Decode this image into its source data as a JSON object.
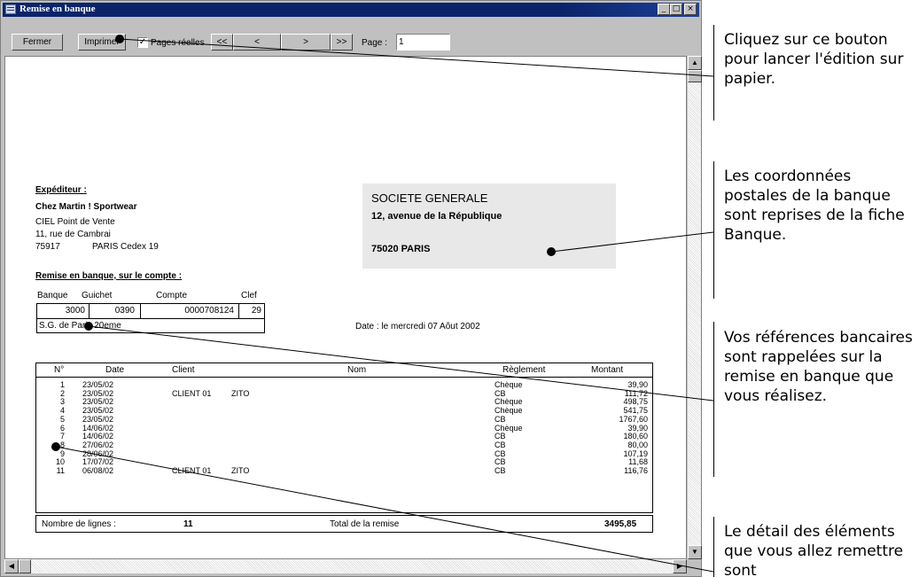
{
  "window": {
    "title": "Remise en banque",
    "min": "_",
    "max": "□",
    "close": "×"
  },
  "toolbar": {
    "close_label": "Fermer",
    "print_label": "Imprimer",
    "real_pages_label": "Pages réelles",
    "real_pages_checked": "✓",
    "first_label": "<<",
    "prev_label": "<",
    "next_label": ">",
    "last_label": ">>",
    "page_label": "Page :",
    "page_value": "1"
  },
  "sender": {
    "heading": "Expéditeur :",
    "name": "Chez Martin ! Sportwear",
    "line1": "CIEL Point de Vente",
    "line2": "11, rue de Cambrai",
    "zip": "75917",
    "city": "PARIS Cedex 19"
  },
  "bank": {
    "name": "SOCIETE GENERALE",
    "address": "12, avenue de la République",
    "city": "75020  PARIS"
  },
  "account": {
    "heading": "Remise en banque, sur le compte :",
    "labels": {
      "bank": "Banque",
      "branch": "Guichet",
      "account": "Compte",
      "key": "Clef"
    },
    "bank": "3000",
    "branch": "0390",
    "account": "0000708124",
    "key": "29",
    "agency": "S.G. de Paris 20eme",
    "date": "Date : le mercredi 07 Aôut 2002"
  },
  "table": {
    "headers": {
      "num": "N°",
      "date": "Date",
      "client": "Client",
      "name": "Nom",
      "payment": "Règlement",
      "amount": "Montant"
    },
    "rows": [
      {
        "num": "1",
        "date": "23/05/02",
        "client": "",
        "name": "",
        "payment": "Chèque",
        "amount": "39,90"
      },
      {
        "num": "2",
        "date": "23/05/02",
        "client": "CLIENT 01",
        "name": "ZITO",
        "payment": "CB",
        "amount": "111,72"
      },
      {
        "num": "3",
        "date": "23/05/02",
        "client": "",
        "name": "",
        "payment": "Chèque",
        "amount": "498,75"
      },
      {
        "num": "4",
        "date": "23/05/02",
        "client": "",
        "name": "",
        "payment": "Chèque",
        "amount": "541,75"
      },
      {
        "num": "5",
        "date": "23/05/02",
        "client": "",
        "name": "",
        "payment": "CB",
        "amount": "1767,60"
      },
      {
        "num": "6",
        "date": "14/06/02",
        "client": "",
        "name": "",
        "payment": "Chèque",
        "amount": "39,90"
      },
      {
        "num": "7",
        "date": "14/06/02",
        "client": "",
        "name": "",
        "payment": "CB",
        "amount": "180,60"
      },
      {
        "num": "8",
        "date": "27/06/02",
        "client": "",
        "name": "",
        "payment": "CB",
        "amount": "80,00"
      },
      {
        "num": "9",
        "date": "28/06/02",
        "client": "",
        "name": "",
        "payment": "CB",
        "amount": "107,19"
      },
      {
        "num": "10",
        "date": "17/07/02",
        "client": "",
        "name": "",
        "payment": "CB",
        "amount": "11,68"
      },
      {
        "num": "11",
        "date": "06/08/02",
        "client": "CLIENT 01",
        "name": "ZITO",
        "payment": "CB",
        "amount": "116,76"
      }
    ],
    "footer": {
      "lines_label": "Nombre de lignes :",
      "lines_value": "11",
      "total_label": "Total de la remise",
      "total_value": "3495,85"
    }
  },
  "callouts": {
    "print": "Cliquez sur ce bouton pour lancer l'édition sur papier.",
    "bank": "Les coordonnées postales de la banque sont reprises de la fiche Banque.",
    "refs": "Vos références bancaires sont rappelées sur la remise en banque que vous réalisez.",
    "detail": "Le détail des éléments que vous allez remettre sont"
  }
}
